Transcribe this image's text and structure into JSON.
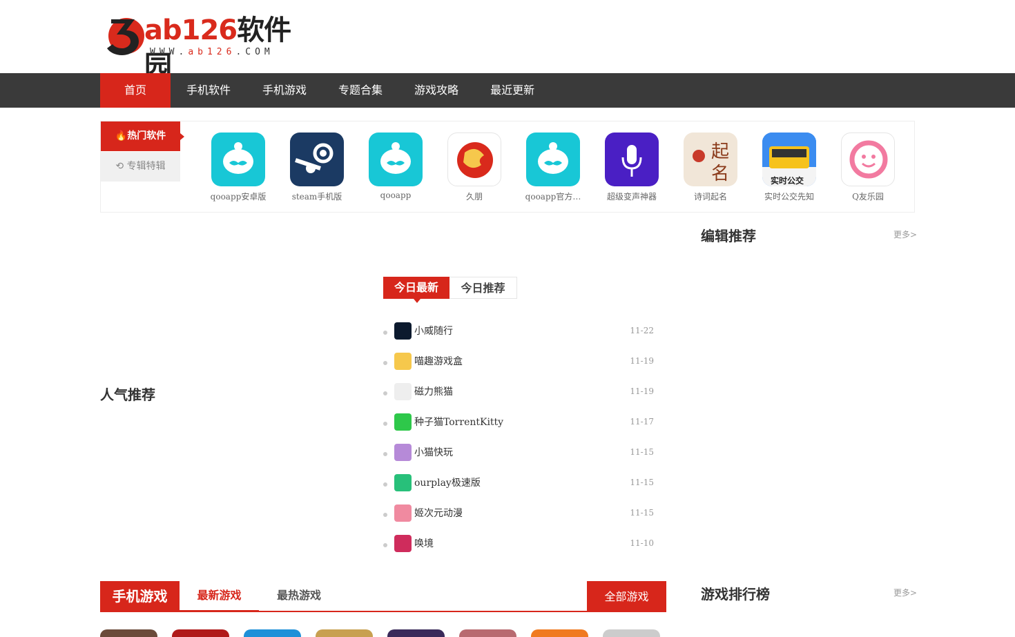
{
  "logo": {
    "brand_prefix": "ab126",
    "brand_suffix": "软件园",
    "url_prefix": "WWW.",
    "url_mid": "ab126",
    "url_suffix": ".COM"
  },
  "nav": [
    "首页",
    "手机软件",
    "手机游戏",
    "专题合集",
    "游戏攻略",
    "最近更新"
  ],
  "hot": {
    "tabs": [
      "热门软件",
      "专辑特辑"
    ],
    "apps": [
      {
        "name": "qooapp安卓版",
        "icon": "qooapp-icon",
        "color": "#18c7d6"
      },
      {
        "name": "steam手机版",
        "icon": "steam-icon",
        "color": "#1b3a63"
      },
      {
        "name": "qooapp",
        "icon": "qooapp-icon",
        "color": "#18c7d6"
      },
      {
        "name": "久朋",
        "icon": "jiupeng-icon",
        "color": "#ffffff"
      },
      {
        "name": "qooapp官方…",
        "icon": "qooapp-icon",
        "color": "#18c7d6"
      },
      {
        "name": "超级变声神器",
        "icon": "microphone-icon",
        "color": "#4a1fc4"
      },
      {
        "name": "诗词起名",
        "icon": "naming-icon",
        "color": "#f1e6d8"
      },
      {
        "name": "实时公交先知",
        "icon": "bus-icon",
        "color": "#3b8cf0"
      },
      {
        "name": "Q友乐园",
        "icon": "smile-icon",
        "color": "#ffffff"
      }
    ]
  },
  "editor_title": "编辑推荐",
  "editor_more": "更多>",
  "popular_title": "人气推荐",
  "today": {
    "tabs": [
      "今日最新",
      "今日推荐"
    ],
    "items": [
      {
        "name": "小威随行",
        "date": "11-22",
        "icon": "xiaowei-icon",
        "color": "#0c1a2e"
      },
      {
        "name": "喵趣游戏盒",
        "date": "11-19",
        "icon": "cat-box-icon",
        "color": "#f6c84c"
      },
      {
        "name": "磁力熊猫",
        "date": "11-19",
        "icon": "panda-icon",
        "color": "#eeeeee"
      },
      {
        "name": "种子猫TorrentKitty",
        "date": "11-17",
        "icon": "torrent-cat-icon",
        "color": "#2ec84a"
      },
      {
        "name": "小猫快玩",
        "date": "11-15",
        "icon": "kitten-icon",
        "color": "#b68ad8"
      },
      {
        "name": "ourplay极速版",
        "date": "11-15",
        "icon": "play-icon",
        "color": "#28c07a"
      },
      {
        "name": "姬次元动漫",
        "date": "11-15",
        "icon": "anime-icon",
        "color": "#f08aa0"
      },
      {
        "name": "唤境",
        "date": "11-10",
        "icon": "huanjing-icon",
        "color": "#cf2c5c"
      }
    ]
  },
  "games": {
    "title": "手机游戏",
    "tabs": [
      "最新游戏",
      "最热游戏"
    ],
    "all": "全部游戏"
  },
  "ranking_title": "游戏排行榜",
  "ranking_more": "更多>",
  "thumb_colors": [
    "#6b4b3a",
    "#b01a1a",
    "#1e90d8",
    "#c8a050",
    "#3a2a5a",
    "#b86a70",
    "#f07a20",
    "#cccccc"
  ]
}
